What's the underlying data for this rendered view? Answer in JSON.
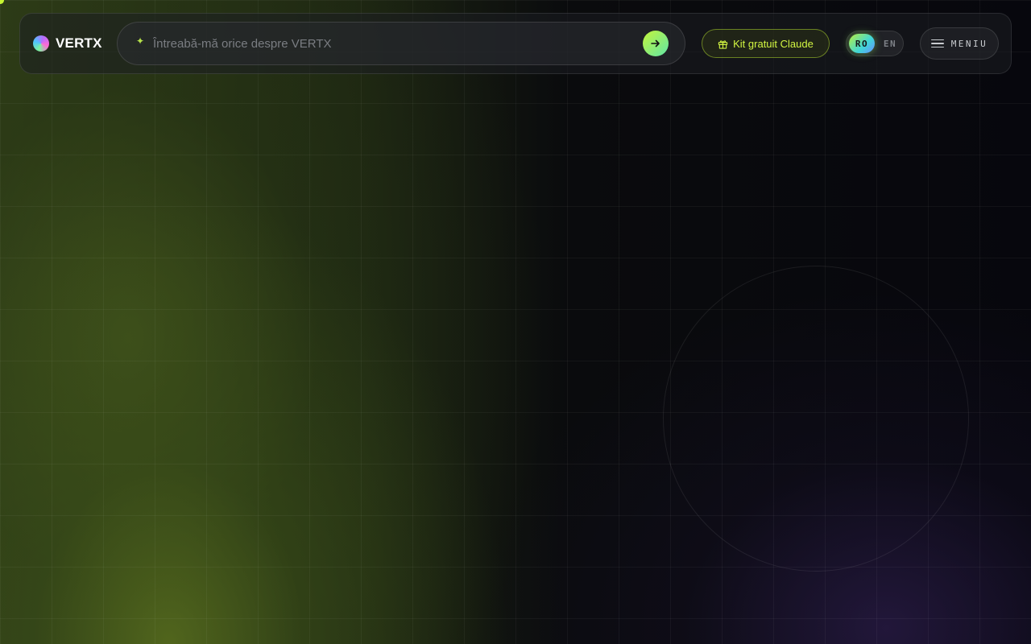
{
  "brand": {
    "name": "VERTX",
    "logo_icon": "gradient-orb-logo"
  },
  "search": {
    "placeholder": "Întreabă-mă orice despre VERTX",
    "value": "",
    "leading_icon": "sparkle-icon",
    "submit_icon": "arrow-right-icon"
  },
  "kit": {
    "label": "Kit gratuit Claude",
    "icon": "gift-icon"
  },
  "language": {
    "options": [
      "RO",
      "EN"
    ],
    "selected": "RO"
  },
  "menu": {
    "label": "MENIU",
    "icon": "hamburger-icon"
  },
  "colors": {
    "accent": "#c6f432",
    "background": "#07070d",
    "green_glow": "#4a5a1e",
    "purple_glow": "#2a1d48"
  }
}
